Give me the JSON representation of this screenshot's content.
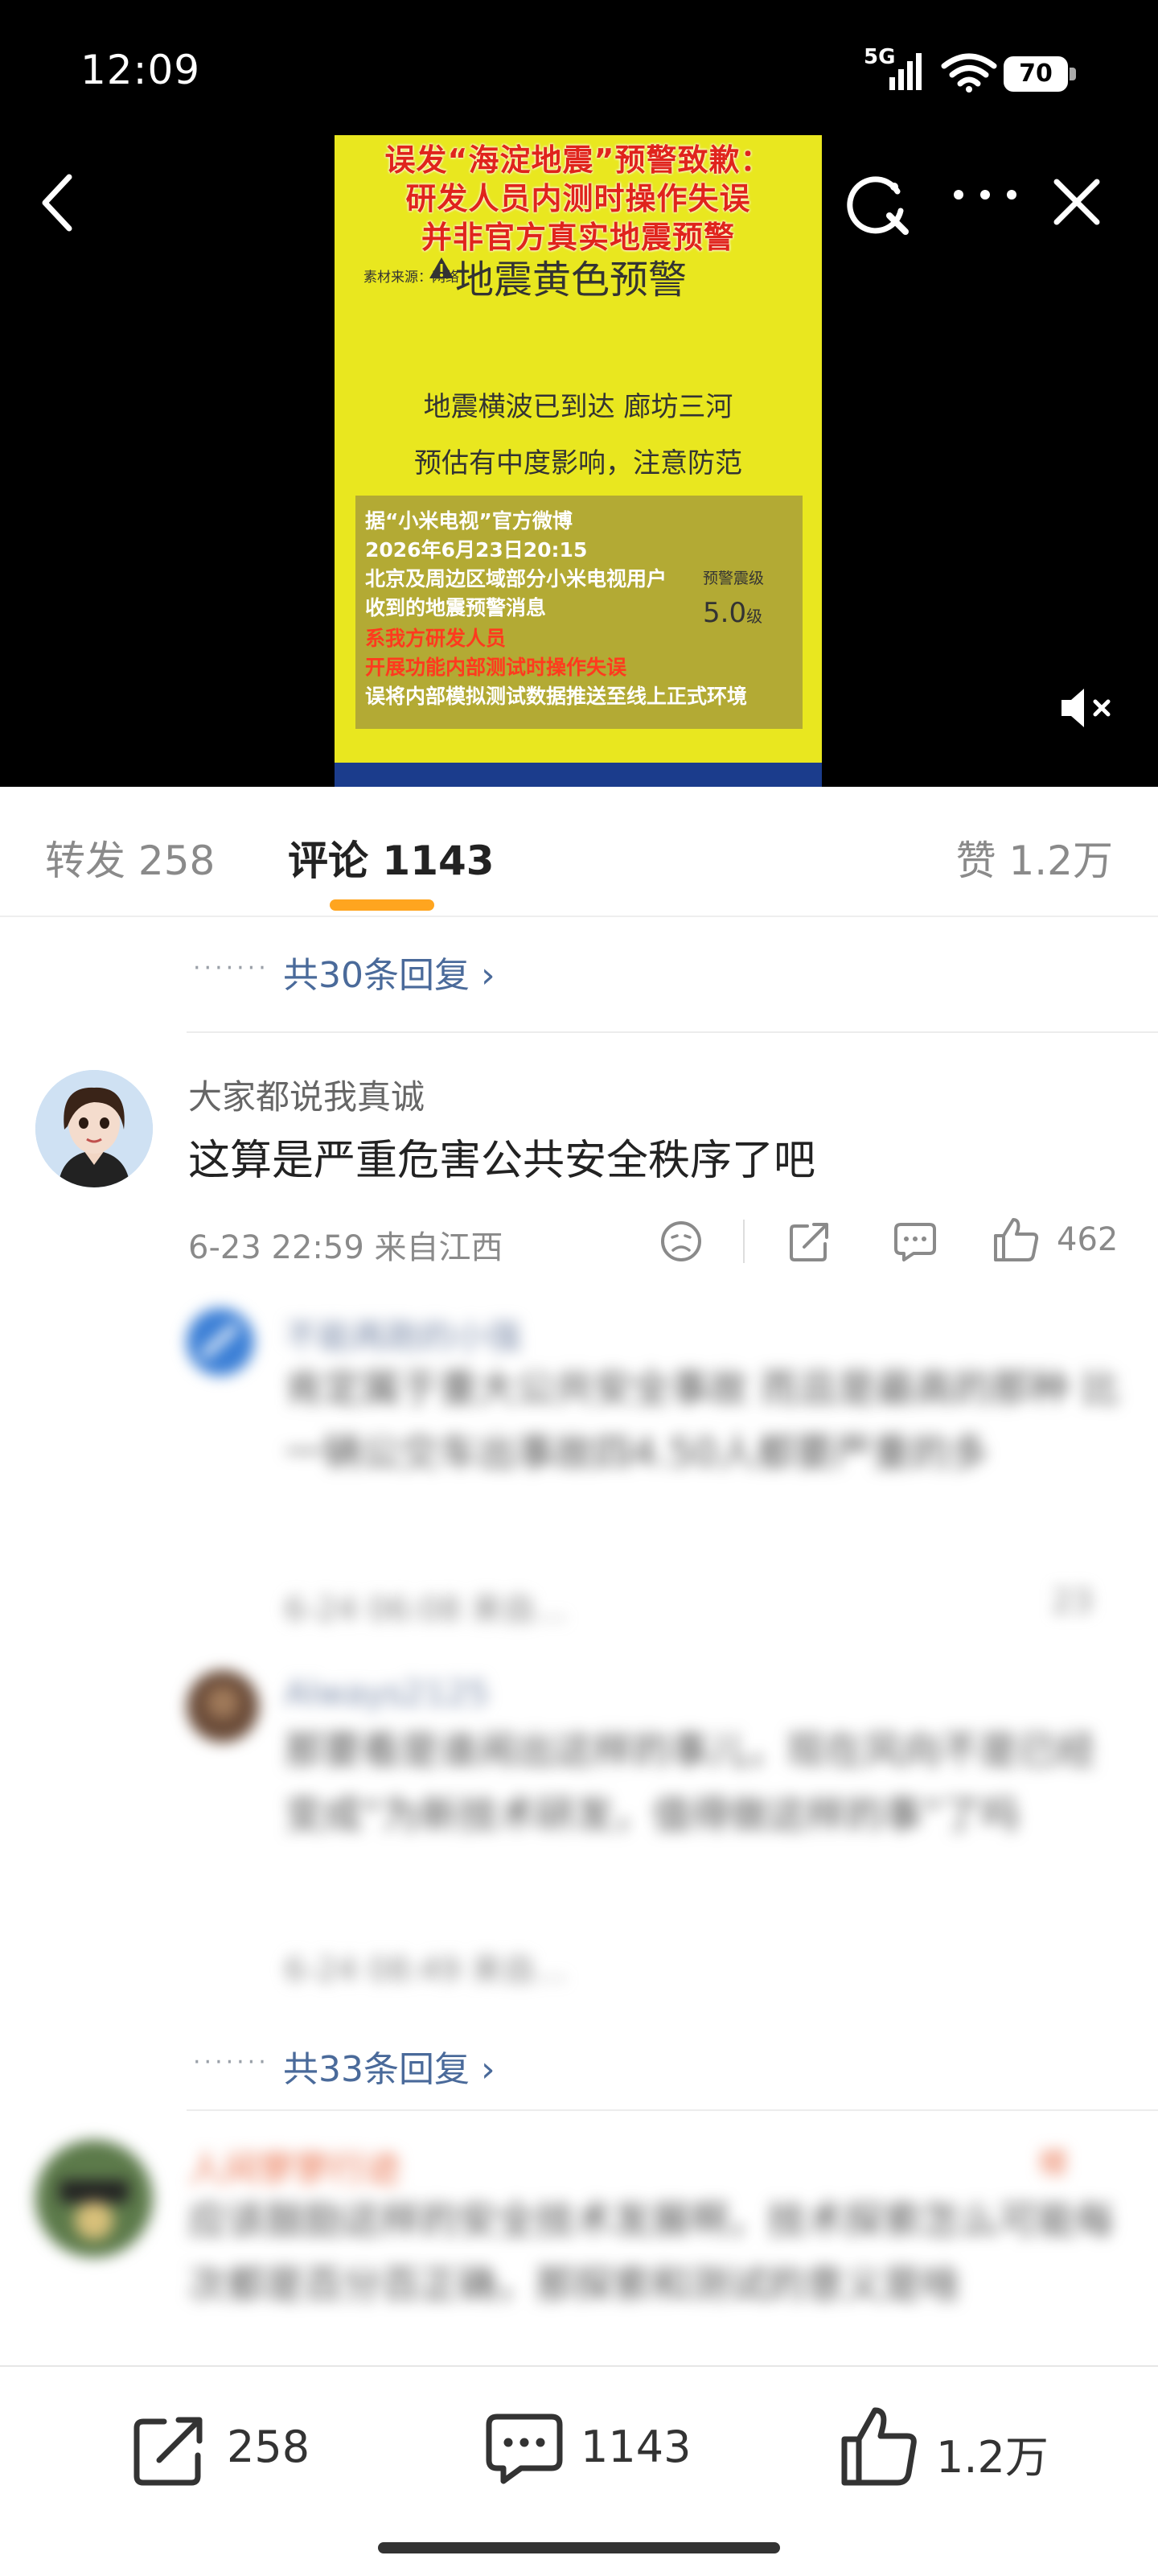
{
  "status_bar": {
    "time": "12:09",
    "network": "5G",
    "battery": "70"
  },
  "video": {
    "poster": {
      "headline_1": "误发“海淀地震”预警致歉：",
      "headline_2": "研发人员内测时操作失误",
      "headline_3": "并非官方真实地震预警",
      "source_tag": "素材来源：网络",
      "warning_title": "地震黄色预警",
      "message_1": "地震横波已到达 廊坊三河",
      "message_2": "预估有中度影响，注意防范",
      "box_lines": [
        "据“小米电视”官方微博",
        "2026年6月23日20:15",
        "北京及周边区域部分小米电视用户",
        "收到的地震预警消息",
        "系我方研发人员",
        "开展功能内部测试时操作失误",
        "误将内部模拟测试数据推送至线上正式环境"
      ],
      "level_label": "预警震级",
      "level_value": "5.0",
      "level_unit": "级"
    }
  },
  "tabs": {
    "repost": "转发 258",
    "comments": "评论 1143",
    "likes": "赞 1.2万",
    "accent_color": "#ffa51f"
  },
  "comments": {
    "more_replies_1": "共30条回复 ›",
    "dots": "·······",
    "first": {
      "username": "大家都说我真诚",
      "text": "这算是严重危害公共安全秩序了吧",
      "meta": "6-23 22:59  来自江西",
      "likes": "462"
    },
    "reply_1": {
      "username": "不能再跑的小强",
      "text": "肯定属于重大公共安全事故 而且是最高的那种 比一辆公交车出事故四4.50人都要严重的多",
      "meta": "6-24 06:08  来自…",
      "likes": "23"
    },
    "reply_2": {
      "username": "Always2125",
      "text": "那要看是谁闹出这样的事儿，现在风向不是已经变成“为新技术研发，值得做这样的事”了吗",
      "meta": "6-24 08:49  来自…"
    },
    "more_replies_2": "共33条回复 ›",
    "second": {
      "username": "人间寥寥行迹",
      "tag": "楼",
      "text": "应该鼓励这样的安全技术发展啊，技术探索怎么可能每次都是百分百正确，那探索和测试的意义是啥"
    }
  },
  "bottom_bar": {
    "share_count": "258",
    "comment_count": "1143",
    "like_count": "1.2万"
  }
}
